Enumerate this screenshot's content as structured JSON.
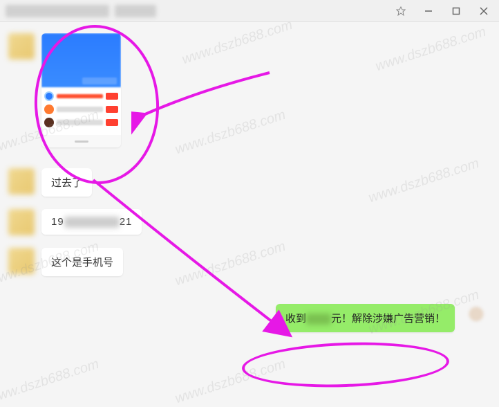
{
  "titlebar": {
    "blur1": "",
    "blur2": ""
  },
  "messages": {
    "m1": {
      "type": "screenshot"
    },
    "m2": {
      "text": "过去了"
    },
    "m3": {
      "prefix": "19",
      "suffix": "21"
    },
    "m4": {
      "text": "这个是手机号"
    },
    "m5": {
      "prefix": "收到",
      "suffix": "元！解除涉嫌广告营销！"
    }
  },
  "watermark": "www.dszb688.com",
  "icons": {
    "pin": "pin-icon",
    "min": "minimize-icon",
    "max": "maximize-icon",
    "close": "close-icon"
  }
}
